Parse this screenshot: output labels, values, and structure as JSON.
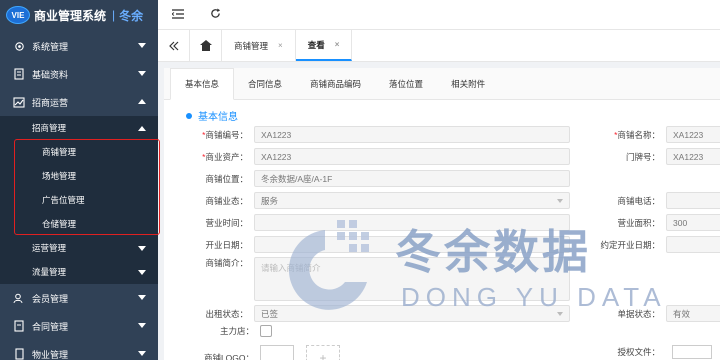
{
  "brand": {
    "logo_text": "VIE",
    "title": "商业管理系统",
    "separator": "|",
    "subtitle": "冬余"
  },
  "sidebar": {
    "items": [
      {
        "label": "系统管理",
        "icon": "gear-icon",
        "expanded": false
      },
      {
        "label": "基础资料",
        "icon": "document-icon",
        "expanded": false
      },
      {
        "label": "招商运营",
        "icon": "chart-icon",
        "expanded": true
      }
    ],
    "sub_group": {
      "label": "招商管理",
      "children": [
        "商铺管理",
        "场地管理",
        "广告位管理",
        "仓储管理"
      ]
    },
    "sub_items": [
      {
        "label": "运营管理"
      },
      {
        "label": "流量管理"
      }
    ],
    "bottom_items": [
      {
        "label": "会员管理",
        "icon": "users-icon"
      },
      {
        "label": "合同管理",
        "icon": "contract-icon"
      },
      {
        "label": "物业管理",
        "icon": "building-icon"
      }
    ]
  },
  "tabs": [
    {
      "label": "商铺管理",
      "active": false
    },
    {
      "label": "查看",
      "active": true
    }
  ],
  "subtabs": [
    "基本信息",
    "合同信息",
    "商铺商品编码",
    "落位位置",
    "相关附件"
  ],
  "section_title": "基本信息",
  "form": {
    "shop_code": {
      "label": "商铺编号：",
      "value": "XA1223"
    },
    "asset": {
      "label": "商业资产：",
      "value": "XA1223"
    },
    "location": {
      "label": "商铺位置：",
      "value": "冬余数据/A座/A-1F"
    },
    "business": {
      "label": "商铺业态：",
      "value": "服务"
    },
    "hours": {
      "label": "营业时间：",
      "value": ""
    },
    "open_date": {
      "label": "开业日期：",
      "value": ""
    },
    "intro": {
      "label": "商铺简介：",
      "placeholder": "请输入商铺简介"
    },
    "rent_status": {
      "label": "出租状态：",
      "value": "已签"
    },
    "main_store": {
      "label": "主力店："
    },
    "logo": {
      "label": "商铺LOGO："
    },
    "shop_name": {
      "label": "商铺名称：",
      "value": "XA1223"
    },
    "door_no": {
      "label": "门牌号：",
      "value": "XA1223"
    },
    "phone": {
      "label": "商铺电话：",
      "value": ""
    },
    "area": {
      "label": "营业面积：",
      "value": "300"
    },
    "contract_open": {
      "label": "约定开业日期：",
      "value": ""
    },
    "unit_status": {
      "label": "单据状态：",
      "value": "有效"
    },
    "license": {
      "label": "授权文件："
    }
  },
  "watermark": {
    "cn": "冬余数据",
    "en": "DONG YU DATA"
  },
  "colors": {
    "sidebar": "#304156",
    "accent": "#1890ff",
    "highlight": "#e02020"
  }
}
